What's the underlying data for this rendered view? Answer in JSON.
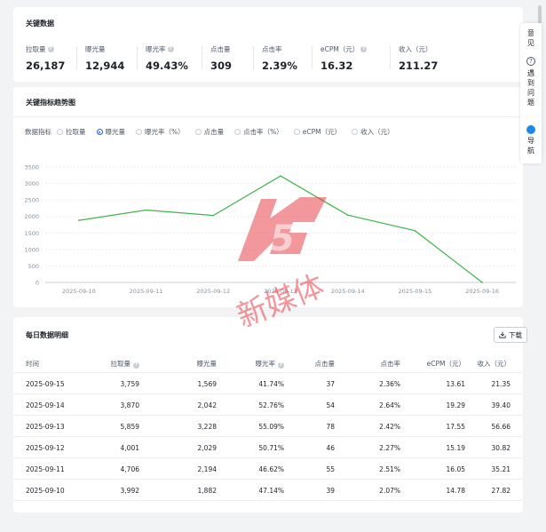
{
  "key_metrics": {
    "title": "关键数据",
    "items": [
      {
        "label": "拉取量",
        "value": "26,187",
        "help": true
      },
      {
        "label": "曝光量",
        "value": "12,944",
        "help": false
      },
      {
        "label": "曝光率",
        "value": "49.43%",
        "help": true
      },
      {
        "label": "点击量",
        "value": "309",
        "help": false
      },
      {
        "label": "点击率",
        "value": "2.39%",
        "help": false
      },
      {
        "label": "eCPM（元）",
        "value": "16.32",
        "help": true
      },
      {
        "label": "收入（元）",
        "value": "211.27",
        "help": false
      }
    ]
  },
  "trend": {
    "title": "关键指标趋势图",
    "indicator_label": "数据指标",
    "options": [
      "拉取量",
      "曝光量",
      "曝光率（%）",
      "点击量",
      "点击率（%）",
      "eCPM（元）",
      "收入（元）"
    ],
    "selected": "曝光量"
  },
  "chart_data": {
    "type": "line",
    "x": [
      "2025-09-10",
      "2025-09-11",
      "2025-09-12",
      "2025-09-13",
      "2025-09-14",
      "2025-09-15",
      "2025-09-16"
    ],
    "series": [
      {
        "values": [
          1882,
          2194,
          2029,
          3228,
          2042,
          1569,
          0
        ],
        "color": "#3eb54a"
      }
    ],
    "ylim": [
      0,
      3500
    ],
    "yticks": [
      "0",
      "500",
      "1000",
      "1500",
      "2000",
      "2500",
      "3000",
      "3500"
    ],
    "grid": true
  },
  "daily": {
    "title": "每日数据明细",
    "download_label": "下载",
    "columns": [
      "时间",
      "拉取量",
      "曝光量",
      "曝光率",
      "点击量",
      "点击率",
      "eCPM（元）",
      "收入（元）"
    ],
    "rows": [
      [
        "2025-09-15",
        "3,759",
        "1,569",
        "41.74%",
        "37",
        "2.36%",
        "13.61",
        "21.35"
      ],
      [
        "2025-09-14",
        "3,870",
        "2,042",
        "52.76%",
        "54",
        "2.64%",
        "19.29",
        "39.40"
      ],
      [
        "2025-09-13",
        "5,859",
        "3,228",
        "55.09%",
        "78",
        "2.42%",
        "17.55",
        "56.66"
      ],
      [
        "2025-09-12",
        "4,001",
        "2,029",
        "50.71%",
        "46",
        "2.27%",
        "15.19",
        "30.82"
      ],
      [
        "2025-09-11",
        "4,706",
        "2,194",
        "46.62%",
        "55",
        "2.51%",
        "16.05",
        "35.21"
      ],
      [
        "2025-09-10",
        "3,992",
        "1,882",
        "47.14%",
        "39",
        "2.07%",
        "14.78",
        "27.82"
      ]
    ]
  },
  "side": {
    "feedback": "意见",
    "problem": "遇到问题",
    "nav": "导航"
  },
  "watermark": {
    "brand": "A5",
    "text": "新媒体"
  }
}
